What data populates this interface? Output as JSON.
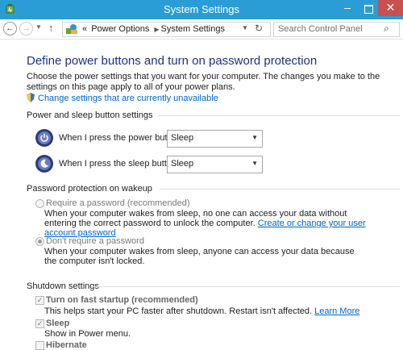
{
  "window": {
    "title": "System Settings",
    "minimize_label": "–",
    "close_label": "✕"
  },
  "nav": {
    "back_label": "←",
    "forward_label": "→",
    "recent_label": "▼",
    "up_label": "↑",
    "breadcrumb": [
      "«",
      "Power Options",
      "System Settings"
    ],
    "address_dropdown": "▼",
    "refresh_label": "↻",
    "search_placeholder": "Search Control Panel",
    "search_icon": "⌕"
  },
  "icons": {
    "power_button": "power-button-icon",
    "sleep_button": "sleep-button-icon",
    "shield": "uac-shield-icon",
    "control_panel": "control-panel-icon"
  },
  "colors": {
    "titlebar": "#2a9dd6",
    "close": "#c75050",
    "heading": "#1e3287",
    "link": "#0066cc"
  },
  "page": {
    "title": "Define power buttons and turn on password protection",
    "description": "Choose the power settings that you want for your computer. The changes you make to the settings on this page apply to all of your power plans.",
    "change_settings_link": "Change settings that are currently unavailable"
  },
  "power_section": {
    "heading": "Power and sleep button settings",
    "power_button_label": "When I press the power button:",
    "power_button_value": "Sleep",
    "sleep_button_label": "When I press the sleep button:",
    "sleep_button_value": "Sleep"
  },
  "password_section": {
    "heading": "Password protection on wakeup",
    "require_label": "Require a password (recommended)",
    "require_desc": "When your computer wakes from sleep, no one can access your data without entering the correct password to unlock the computer.",
    "require_link": "Create or change your user account password",
    "no_require_label": "Don't require a password",
    "no_require_desc": "When your computer wakes from sleep, anyone can access your data because the computer isn't locked.",
    "selected": "no_require"
  },
  "shutdown_section": {
    "heading": "Shutdown settings",
    "fast_startup_label": "Turn on fast startup (recommended)",
    "fast_startup_desc": "This helps start your PC faster after shutdown. Restart isn't affected.",
    "learn_more": "Learn More",
    "fast_startup_checked": true,
    "sleep_label": "Sleep",
    "sleep_desc": "Show in Power menu.",
    "sleep_checked": true,
    "hibernate_label": "Hibernate",
    "hibernate_checked": false,
    "check_mark": "✓"
  }
}
